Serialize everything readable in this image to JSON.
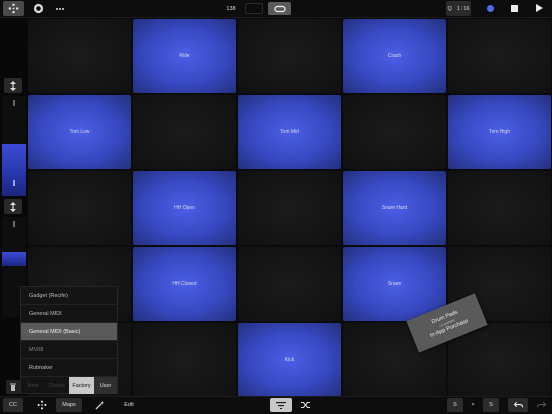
{
  "toolbar": {
    "tempo": "138",
    "quantize_value": "Q",
    "quantize_divider": "1",
    "quantize_sub": "16"
  },
  "pads": [
    {
      "label": "",
      "active": false
    },
    {
      "label": "Ride",
      "active": true
    },
    {
      "label": "",
      "active": false
    },
    {
      "label": "Crash",
      "active": true
    },
    {
      "label": "",
      "active": false
    },
    {
      "label": "Tom Low",
      "active": true
    },
    {
      "label": "",
      "active": false
    },
    {
      "label": "Tom Mid",
      "active": true
    },
    {
      "label": "",
      "active": false
    },
    {
      "label": "Tom High",
      "active": true
    },
    {
      "label": "",
      "active": false
    },
    {
      "label": "HH Open",
      "active": true
    },
    {
      "label": "",
      "active": false
    },
    {
      "label": "Snare Hard",
      "active": true
    },
    {
      "label": "",
      "active": false
    },
    {
      "label": "",
      "active": false
    },
    {
      "label": "HH Closed",
      "active": true
    },
    {
      "label": "",
      "active": false
    },
    {
      "label": "Snare",
      "active": true
    },
    {
      "label": "",
      "active": false
    },
    {
      "label": "",
      "active": false
    },
    {
      "label": "",
      "active": false
    },
    {
      "label": "Kick",
      "active": true
    },
    {
      "label": "",
      "active": false
    },
    {
      "label": "",
      "active": false
    }
  ],
  "map_menu": {
    "items": [
      {
        "label": "Gadget (Recife)"
      },
      {
        "label": "General MIDI"
      },
      {
        "label": "General MIDI (Basic)",
        "selected": true
      },
      {
        "label": "MV08",
        "muted": true
      },
      {
        "label": "Rutmaker"
      }
    ],
    "tabs": {
      "new": "New",
      "delete": "Delete",
      "factory": "Factory",
      "user": "User"
    }
  },
  "promo": {
    "line1": "Drum Pads",
    "line2": "not available",
    "line3": "In-App Purchase"
  },
  "bottombar": {
    "cc": "CC",
    "maps": "Maps",
    "edit": "Edit",
    "left_s": "S",
    "x": "×",
    "right_s": "S"
  },
  "colors": {
    "pad_active": "#3748c0",
    "pad_inactive": "#151515",
    "accent": "#4f6cf0"
  }
}
